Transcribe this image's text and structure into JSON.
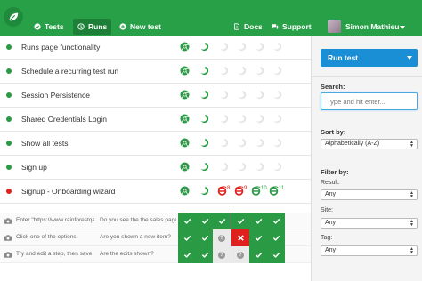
{
  "nav": {
    "tests_label": "Tests",
    "runs_label": "Runs",
    "new_test_label": "New test",
    "docs_label": "Docs",
    "support_label": "Support",
    "user_name": "Simon Mathieu"
  },
  "tests": [
    {
      "name": "Runs page functionality",
      "status": "pass"
    },
    {
      "name": "Schedule a recurring test run",
      "status": "pass"
    },
    {
      "name": "Session Persistence",
      "status": "pass"
    },
    {
      "name": "Shared Credentials Login",
      "status": "pass"
    },
    {
      "name": "Show all tests",
      "status": "pass"
    },
    {
      "name": "Sign up",
      "status": "pass"
    },
    {
      "name": "Signup - Onboarding wizard",
      "status": "fail"
    }
  ],
  "failure_counts": {
    "a": "8",
    "b": "9",
    "c": "10",
    "d": "11"
  },
  "steps": [
    {
      "action": "Enter \"https://www.rainforestqa.com\"",
      "question": "Do you see the the sales page?",
      "results": [
        "pass",
        "pass",
        "pass",
        "pass",
        "pass",
        "pass"
      ]
    },
    {
      "action": "Click one of the options",
      "question": "Are you shown a new item?",
      "results": [
        "pass",
        "pass",
        "unknown",
        "fail",
        "pass",
        "pass"
      ]
    },
    {
      "action": "Try and edit a step, then save",
      "question": "Are the edits shown?",
      "results": [
        "pass",
        "pass",
        "unknown",
        "unknown",
        "pass",
        "pass"
      ]
    }
  ],
  "sidebar": {
    "run_button": "Run test",
    "search_label": "Search:",
    "search_placeholder": "Type and hit enter...",
    "sort_label": "Sort by:",
    "sort_value": "Alphabetically (A-Z)",
    "filter_label": "Filter by:",
    "result_label": "Result:",
    "result_value": "Any",
    "site_label": "Site:",
    "site_value": "Any",
    "tag_label": "Tag:",
    "tag_value": "Any"
  },
  "colors": {
    "brand_green": "#27a047",
    "pass": "#2a9a45",
    "fail": "#e0201c",
    "primary_blue": "#1a8fd6"
  }
}
